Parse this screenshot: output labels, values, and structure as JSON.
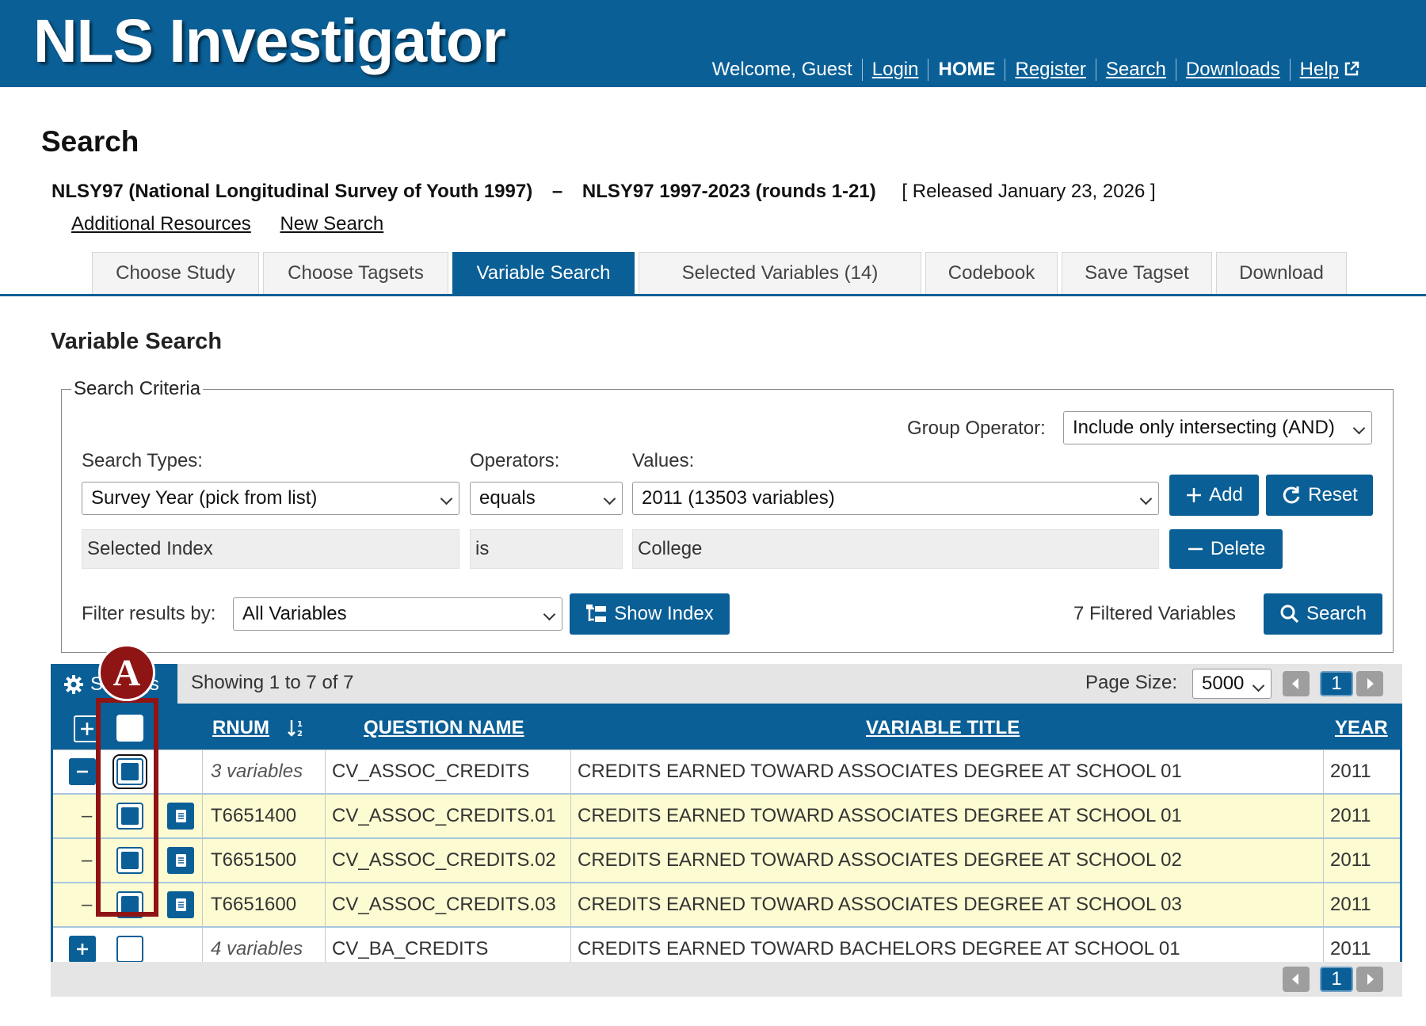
{
  "header": {
    "title": "NLS Investigator",
    "welcome": "Welcome, Guest",
    "nav": [
      "Login",
      "HOME",
      "Register",
      "Search",
      "Downloads",
      "Help"
    ]
  },
  "page_title": "Search",
  "study": {
    "name": "NLSY97 (National Longitudinal Survey of Youth 1997)",
    "separator": "–",
    "release": "NLSY97 1997-2023 (rounds 1-21)",
    "released": "[ Released January 23, 2026 ]"
  },
  "sublinks": [
    "Additional Resources",
    "New Search"
  ],
  "tabs": [
    "Choose Study",
    "Choose Tagsets",
    "Variable Search",
    "Selected Variables (14)",
    "Codebook",
    "Save Tagset",
    "Download"
  ],
  "section_title": "Variable Search",
  "criteria": {
    "legend": "Search Criteria",
    "group_operator_label": "Group Operator:",
    "group_operator_value": "Include only intersecting (AND)",
    "search_types_label": "Search Types:",
    "operators_label": "Operators:",
    "values_label": "Values:",
    "search_type_value": "Survey Year (pick from list)",
    "operator_value": "equals",
    "value_value": "2011 (13503 variables)",
    "add_label": "Add",
    "reset_label": "Reset",
    "row2": {
      "type": "Selected Index",
      "operator": "is",
      "value": "College"
    },
    "delete_label": "Delete",
    "filter_label": "Filter results by:",
    "filter_value": "All Variables",
    "show_index_label": "Show Index",
    "filtered_count": "7 Filtered Variables",
    "search_label": "Search"
  },
  "results": {
    "settings_label": "Settings",
    "showing": "Showing 1 to 7 of 7",
    "page_size_label": "Page Size:",
    "page_size_value": "5000",
    "page": "1",
    "columns": [
      "RNUM",
      "QUESTION NAME",
      "VARIABLE TITLE",
      "YEAR"
    ],
    "rows": [
      {
        "rnum": "3 variables",
        "qname": "CV_ASSOC_CREDITS",
        "title": "CREDITS EARNED TOWARD ASSOCIATES DEGREE AT SCHOOL 01",
        "year": "2011"
      },
      {
        "rnum": "T6651400",
        "qname": "CV_ASSOC_CREDITS.01",
        "title": "CREDITS EARNED TOWARD ASSOCIATES DEGREE AT SCHOOL 01",
        "year": "2011"
      },
      {
        "rnum": "T6651500",
        "qname": "CV_ASSOC_CREDITS.02",
        "title": "CREDITS EARNED TOWARD ASSOCIATES DEGREE AT SCHOOL 02",
        "year": "2011"
      },
      {
        "rnum": "T6651600",
        "qname": "CV_ASSOC_CREDITS.03",
        "title": "CREDITS EARNED TOWARD ASSOCIATES DEGREE AT SCHOOL 03",
        "year": "2011"
      },
      {
        "rnum": "4 variables",
        "qname": "CV_BA_CREDITS",
        "title": "CREDITS EARNED TOWARD BACHELORS DEGREE AT SCHOOL 01",
        "year": "2011"
      }
    ]
  },
  "annotation": {
    "label": "A"
  },
  "colors": {
    "brand": "#0a5f96",
    "highlight_row": "#fdfbd2",
    "annotation": "#8f1414"
  }
}
